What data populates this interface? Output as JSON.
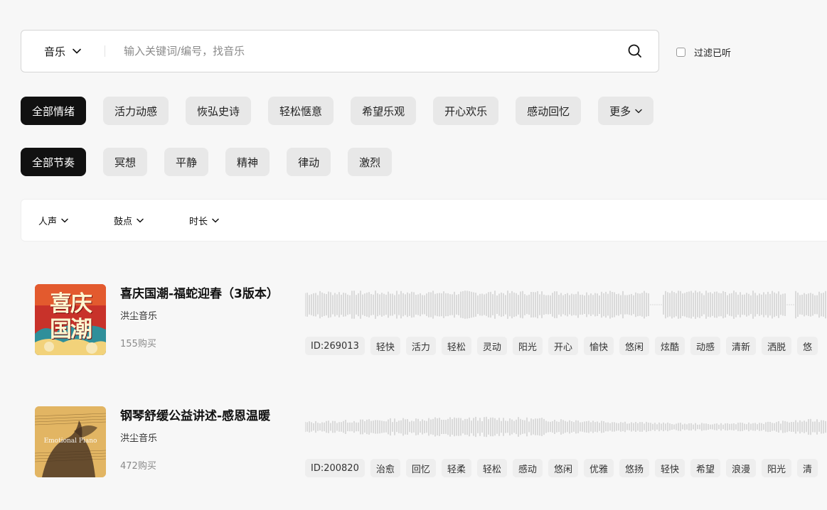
{
  "search": {
    "category": "音乐",
    "placeholder": "输入关键词/编号，找音乐"
  },
  "filter_heard_label": "过滤已听",
  "mood_chips": [
    "全部情绪",
    "活力动感",
    "恢弘史诗",
    "轻松惬意",
    "希望乐观",
    "开心欢乐",
    "感动回忆"
  ],
  "mood_more": "更多",
  "rhythm_chips": [
    "全部节奏",
    "冥想",
    "平静",
    "精神",
    "律动",
    "激烈"
  ],
  "subfilters": [
    "人声",
    "鼓点",
    "时长"
  ],
  "tracks": [
    {
      "title": "喜庆国潮-福蛇迎春（3版本）",
      "artist": "洪尘音乐",
      "buys": "155购买",
      "cover_text": "喜庆国潮",
      "tags": [
        "ID:269013",
        "轻快",
        "活力",
        "轻松",
        "灵动",
        "阳光",
        "开心",
        "愉快",
        "悠闲",
        "炫酷",
        "动感",
        "清新",
        "洒脱",
        "悠"
      ]
    },
    {
      "title": "钢琴舒缓公益讲述-感恩温暖",
      "artist": "洪尘音乐",
      "buys": "472购买",
      "cover_text": "Emotional Piano",
      "tags": [
        "ID:200820",
        "治愈",
        "回忆",
        "轻柔",
        "轻松",
        "感动",
        "悠闲",
        "优雅",
        "悠扬",
        "轻快",
        "希望",
        "浪漫",
        "阳光",
        "清"
      ]
    }
  ],
  "colors": {
    "background": "#f7f7f7",
    "chip_active": "#111111",
    "chip": "#e8e8e8",
    "waveform": "#bdbdbd"
  },
  "icons": {
    "search": "search-icon",
    "chevron": "chevron-down-icon"
  }
}
